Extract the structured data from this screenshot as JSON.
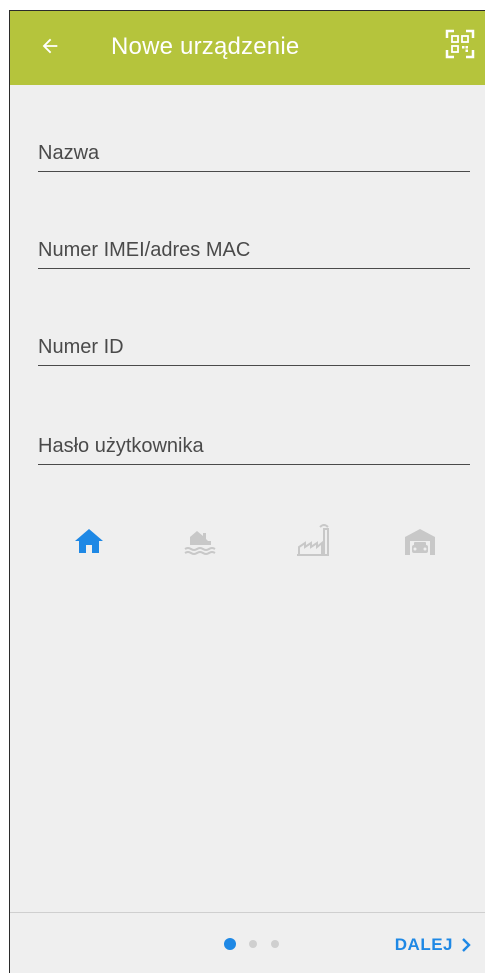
{
  "header": {
    "title": "Nowe urządzenie",
    "back_icon": "arrow-left-icon",
    "qr_icon": "qr-code-scan-icon",
    "background_color": "#b5c43c"
  },
  "form": {
    "fields": [
      {
        "name": "name",
        "placeholder": "Nazwa",
        "value": ""
      },
      {
        "name": "imei_mac",
        "placeholder": "Numer IMEI/adres MAC",
        "value": ""
      },
      {
        "name": "id",
        "placeholder": "Numer ID",
        "value": ""
      },
      {
        "name": "user_password",
        "placeholder": "Hasło użytkownika",
        "value": ""
      }
    ]
  },
  "device_types": {
    "selected": "house",
    "items": [
      {
        "icon": "house-icon",
        "active_color": "#1e88e5"
      },
      {
        "icon": "lake-house-icon"
      },
      {
        "icon": "factory-icon"
      },
      {
        "icon": "garage-icon"
      }
    ]
  },
  "footer": {
    "page_indicator": {
      "current": 1,
      "total": 3
    },
    "next_label": "DALEJ",
    "next_icon": "chevron-right-icon",
    "accent_color": "#1e88e5"
  }
}
